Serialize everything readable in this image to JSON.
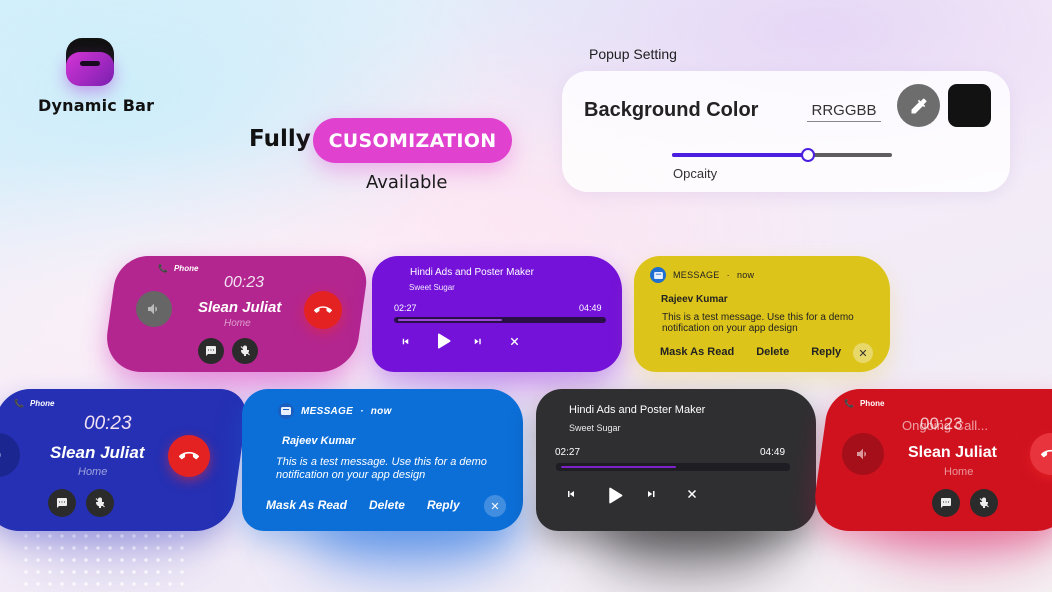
{
  "app": {
    "title": "Dynamic Bar"
  },
  "headline": {
    "prefix": "Fully",
    "highlight": "CUSOMIZATION",
    "suffix": "Available",
    "highlight_color": "#e042cf"
  },
  "popup_setting": {
    "section_label": "Popup Setting",
    "background_color_label": "Background Color",
    "hex_placeholder": "RRGGBB",
    "hex_value": "",
    "color_picker_icon": "eyedropper-icon",
    "selected_color": "#121212",
    "opacity_label": "Opcaity",
    "opacity_value": 0.62,
    "accent_color": "#4b1fe0"
  },
  "call_cards": [
    {
      "theme": "magenta",
      "bg": "#b4268f",
      "source": "Phone",
      "timer": "00:23",
      "caller": "Slean Juliat",
      "label": "Home",
      "icons": [
        "phone-icon",
        "speaker-icon",
        "end-call-icon",
        "message-icon",
        "mute-mic-icon"
      ]
    },
    {
      "theme": "blue",
      "bg": "#2530b4",
      "source": "Phone",
      "timer": "00:23",
      "caller": "Slean Juliat",
      "label": "Home",
      "icons": [
        "phone-icon",
        "speaker-icon",
        "end-call-icon",
        "message-icon",
        "mute-mic-icon"
      ]
    },
    {
      "theme": "red",
      "bg": "#d0121f",
      "source": "Phone",
      "timer": "00:23",
      "status": "Ongoing Call...",
      "caller": "Slean Juliat",
      "label": "Home",
      "icons": [
        "phone-icon",
        "speaker-icon",
        "end-call-icon",
        "message-icon",
        "mute-mic-icon"
      ]
    }
  ],
  "music_cards": [
    {
      "theme": "purple",
      "bg": "#7412d9",
      "title": "Hindi Ads and Poster Maker",
      "artist": "Sweet Sugar",
      "elapsed": "02:27",
      "duration": "04:49",
      "progress": 0.51,
      "controls": [
        "previous",
        "play",
        "next",
        "close"
      ]
    },
    {
      "theme": "dark",
      "bg": "#2f2f31",
      "title": "Hindi Ads and Poster Maker",
      "artist": "Sweet Sugar",
      "elapsed": "02:27",
      "duration": "04:49",
      "progress": 0.51,
      "controls": [
        "previous",
        "play",
        "next",
        "close"
      ]
    }
  ],
  "message_cards": [
    {
      "theme": "yellow",
      "bg": "#dcc41a",
      "app": "MESSAGE",
      "time": "now",
      "sender": "Rajeev Kumar",
      "body": "This is a test message. Use this for a demo notification on your app design",
      "actions": [
        "Mask As Read",
        "Delete",
        "Reply"
      ]
    },
    {
      "theme": "blue",
      "bg": "#0c6fd8",
      "app": "MESSAGE",
      "time": "now",
      "sender": "Rajeev Kumar",
      "body": "This is a test message. Use this for a demo notification on your app design",
      "actions": [
        "Mask As Read",
        "Delete",
        "Reply"
      ]
    }
  ]
}
